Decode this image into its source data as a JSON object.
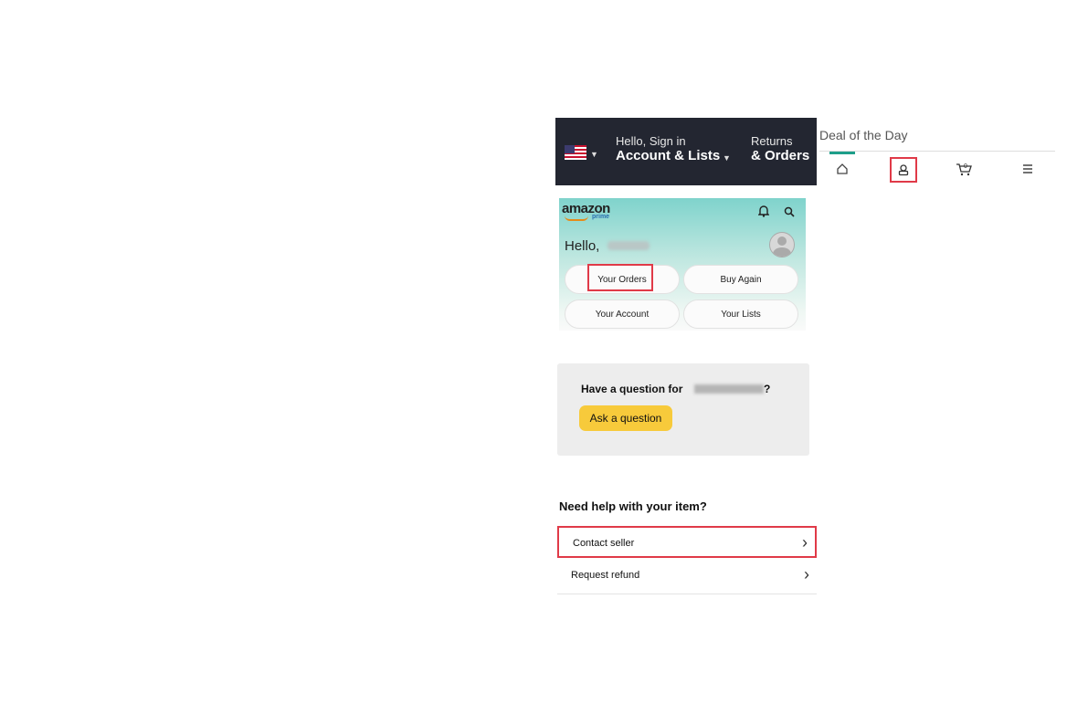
{
  "header": {
    "hello_sign_in": "Hello, Sign in",
    "account_lists": "Account & Lists",
    "returns": "Returns",
    "orders": "& Orders",
    "deal_of_day": "Deal of the Day"
  },
  "bottom_nav": {
    "icons": [
      "home-icon",
      "account-icon",
      "cart-icon",
      "menu-icon"
    ],
    "cart_count": "0",
    "highlight_color": "#e03a48"
  },
  "mobile": {
    "logo": "amazon",
    "logo_sub": "prime",
    "greeting": "Hello,",
    "buttons": {
      "your_orders": "Your Orders",
      "buy_again": "Buy Again",
      "your_account": "Your Account",
      "your_lists": "Your Lists"
    }
  },
  "question": {
    "text": "Have a question for",
    "suffix": "?",
    "button": "Ask a question",
    "button_color": "#f7ca3b"
  },
  "help": {
    "title": "Need help with your item?",
    "items": [
      {
        "label": "Contact seller"
      },
      {
        "label": "Request refund"
      }
    ]
  }
}
